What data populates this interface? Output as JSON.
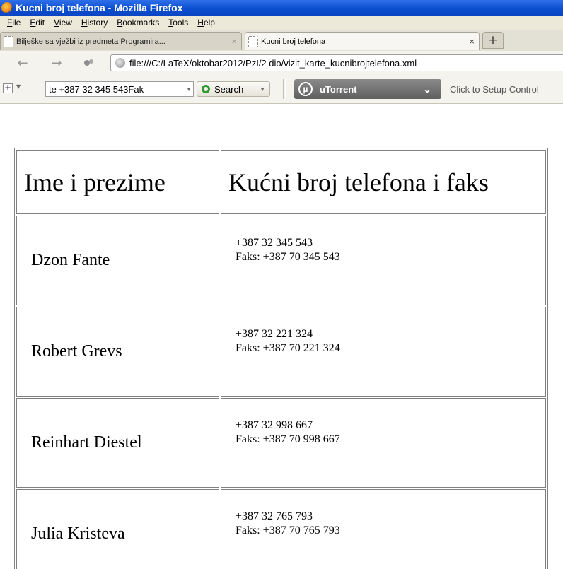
{
  "window": {
    "title": "Kucni broj telefona - Mozilla Firefox"
  },
  "menu": [
    "File",
    "Edit",
    "View",
    "History",
    "Bookmarks",
    "Tools",
    "Help"
  ],
  "tabs": [
    {
      "label": "Bilješke sa vježbi iz predmeta Programira...",
      "close": "×"
    },
    {
      "label": "Kucni broj telefona",
      "close": "×"
    }
  ],
  "new_tab": "+",
  "nav": {
    "back": "←",
    "forward": "→",
    "url": "file:///C:/LaTeX/oktobar2012/PzI/2 dio/vizit_karte_kucnibrojtelefona.xml"
  },
  "toolbar": {
    "search_value": "te    +387 32 345 543Fak",
    "search_button": "Search",
    "utorrent": "uTorrent",
    "setup_text": "Click to Setup Control"
  },
  "table": {
    "headers": [
      "Ime i prezime",
      "Kućni broj telefona i faks"
    ],
    "rows": [
      {
        "name": "Dzon Fante",
        "phone": "+387 32 345 543",
        "fax": "Faks: +387 70 345 543"
      },
      {
        "name": "Robert Grevs",
        "phone": "+387 32 221 324",
        "fax": "Faks: +387 70 221 324"
      },
      {
        "name": "Reinhart Diestel",
        "phone": "+387 32 998 667",
        "fax": "Faks: +387 70 998 667"
      },
      {
        "name": "Julia Kristeva",
        "phone": "+387 32 765 793",
        "fax": "Faks: +387 70 765 793"
      }
    ]
  },
  "colors": {
    "titlebar": "#0b4fd0",
    "menubar": "#ece9d8",
    "utorrent": "#6f6f6f"
  }
}
